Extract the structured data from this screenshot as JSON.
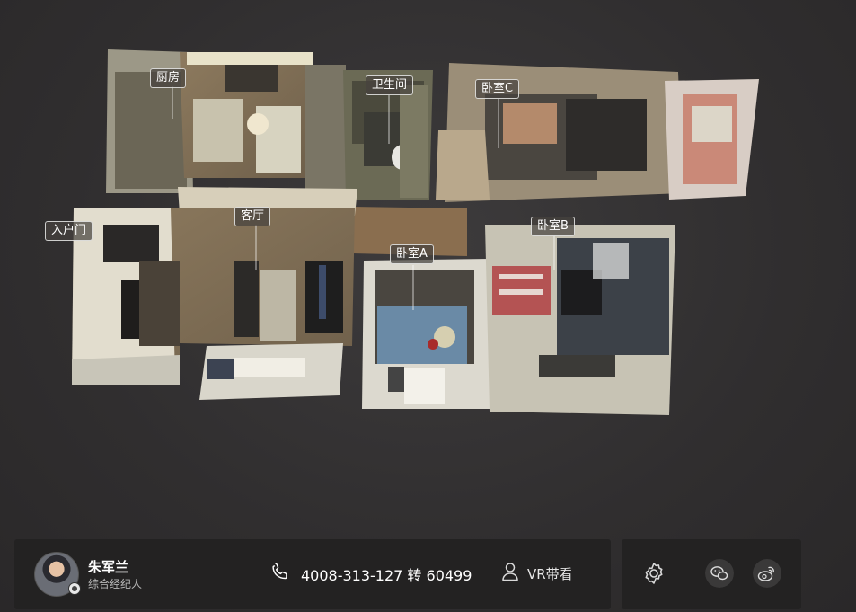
{
  "rooms": {
    "kitchen": "厨房",
    "bathroom": "卫生间",
    "bedroom_c": "卧室C",
    "entrance": "入户门",
    "living_room": "客厅",
    "bedroom_b": "卧室B",
    "bedroom_a": "卧室A"
  },
  "agent": {
    "name": "朱军兰",
    "title": "综合经纪人",
    "phone": "4008-313-127 转 60499",
    "vr_label": "VR带看"
  },
  "toolbar": {
    "icons": [
      "settings-icon",
      "wechat-icon",
      "weibo-icon"
    ]
  }
}
